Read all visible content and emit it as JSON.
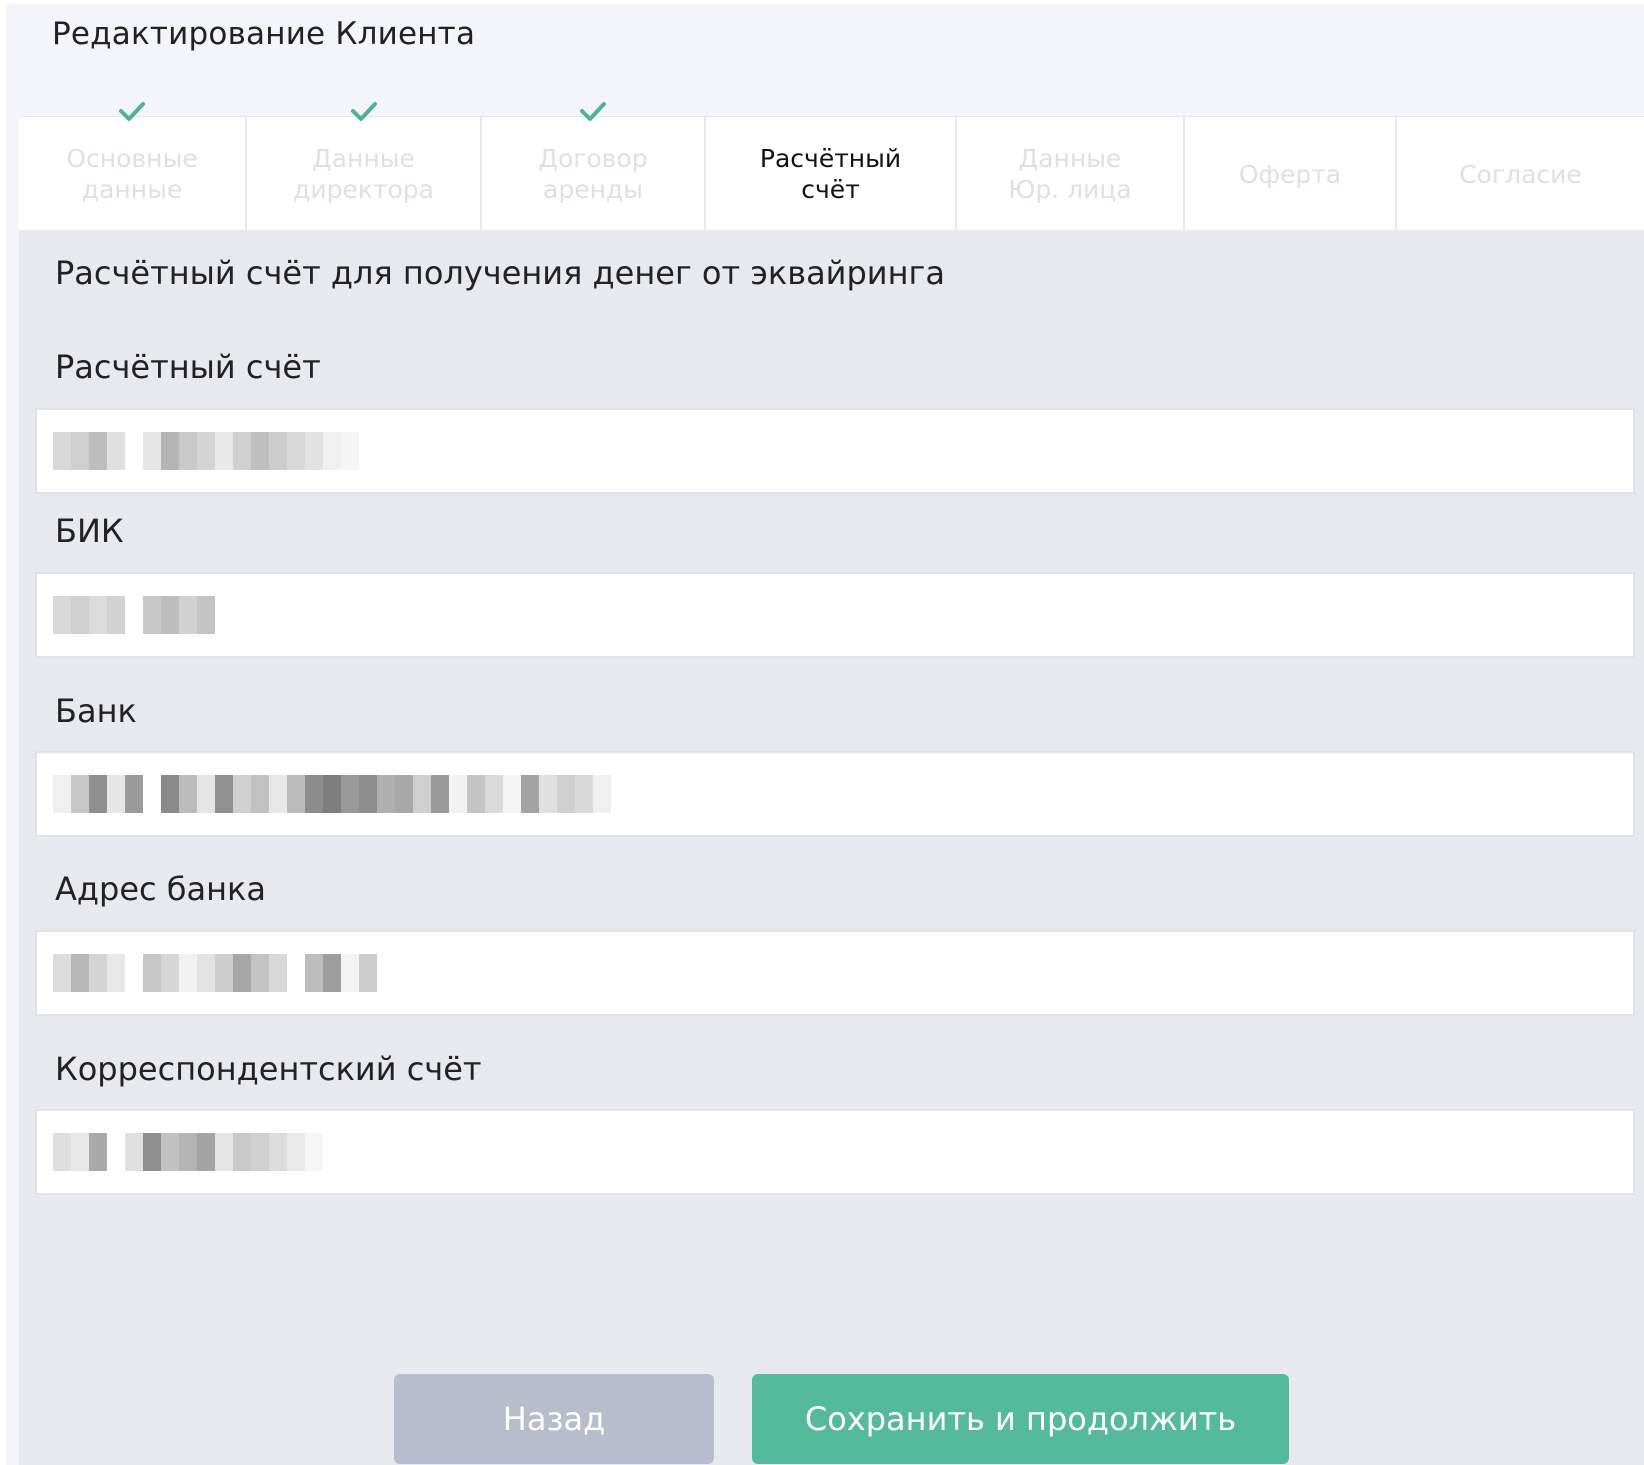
{
  "header": {
    "title": "Редактирование Клиента"
  },
  "tabs": [
    {
      "label": "Основные\nданные",
      "completed": true,
      "active": false
    },
    {
      "label": "Данные\nдиректора",
      "completed": true,
      "active": false
    },
    {
      "label": "Договор\nаренды",
      "completed": true,
      "active": false
    },
    {
      "label": "Расчётный\nсчёт",
      "completed": false,
      "active": true
    },
    {
      "label": "Данные\nЮр. лица",
      "completed": false,
      "active": false
    },
    {
      "label": "Оферта",
      "completed": false,
      "active": false
    },
    {
      "label": "Согласие",
      "completed": false,
      "active": false
    }
  ],
  "form": {
    "section_title": "Расчётный счёт для получения денег от эквайринга",
    "fields": [
      {
        "label": "Расчётный счёт",
        "value_redacted": true
      },
      {
        "label": "БИК",
        "value_redacted": true
      },
      {
        "label": "Банк",
        "value_redacted": true
      },
      {
        "label": "Адрес банка",
        "value_redacted": true
      },
      {
        "label": "Корреспондентский счёт",
        "value_redacted": true
      }
    ]
  },
  "buttons": {
    "back_label": "Назад",
    "save_label": "Сохранить и продолжить"
  },
  "colors": {
    "accent": "#55b99c",
    "check": "#4db493",
    "disabled_button": "#b7bdcc",
    "background": "#e7e9ef"
  },
  "icons": {
    "tab_completed": "checkmark-icon"
  }
}
